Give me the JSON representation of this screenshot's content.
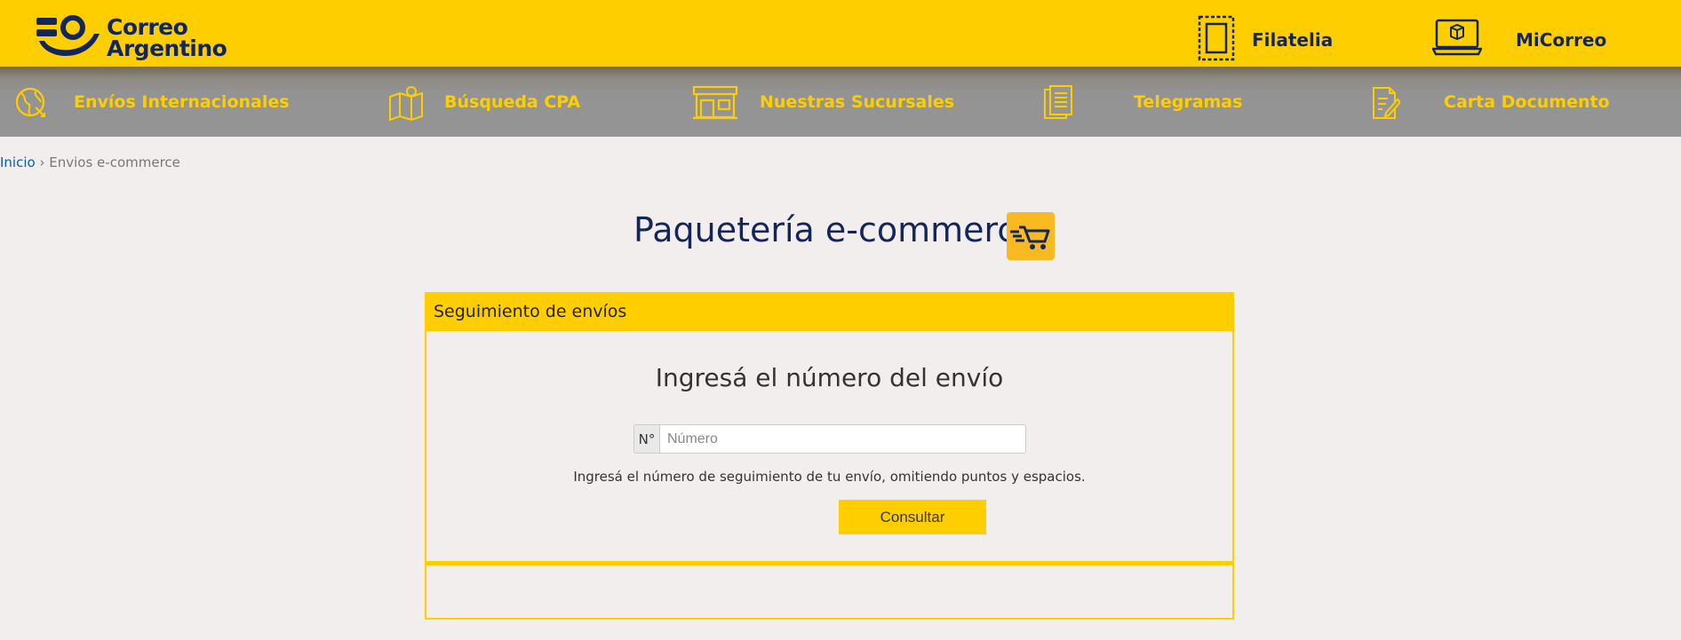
{
  "header": {
    "logo_line1": "Correo",
    "logo_line2": "Argentino",
    "links": [
      {
        "label": "Filatelia",
        "icon": "stamp-icon"
      },
      {
        "label": "MiCorreo",
        "icon": "laptop-package-icon"
      }
    ]
  },
  "nav": {
    "items": [
      {
        "label": "Envíos Internacionales",
        "icon": "globe-icon"
      },
      {
        "label": "Búsqueda CPA",
        "icon": "map-pin-icon"
      },
      {
        "label": "Nuestras Sucursales",
        "icon": "store-icon"
      },
      {
        "label": "Telegramas",
        "icon": "documents-icon"
      },
      {
        "label": "Carta Documento",
        "icon": "document-edit-icon"
      }
    ]
  },
  "breadcrumb": {
    "home": "Inicio",
    "separator": "›",
    "current": "Envios e-commerce"
  },
  "page": {
    "title": "Paquetería e-commerce",
    "title_icon": "shopping-cart-icon"
  },
  "tracking": {
    "panel_title": "Seguimiento de envíos",
    "prompt": "Ingresá el número del envío",
    "addon": "N°",
    "input_value": "",
    "input_placeholder": "Número",
    "hint": "Ingresá el número de seguimiento de tu envío, omitiendo puntos y espacios.",
    "button_label": "Consultar"
  },
  "colors": {
    "brand_yellow": "#ffce00",
    "brand_navy": "#13265c",
    "nav_gray": "#959595",
    "page_bg": "#f2eeee",
    "link_blue": "#0a5fa8"
  }
}
